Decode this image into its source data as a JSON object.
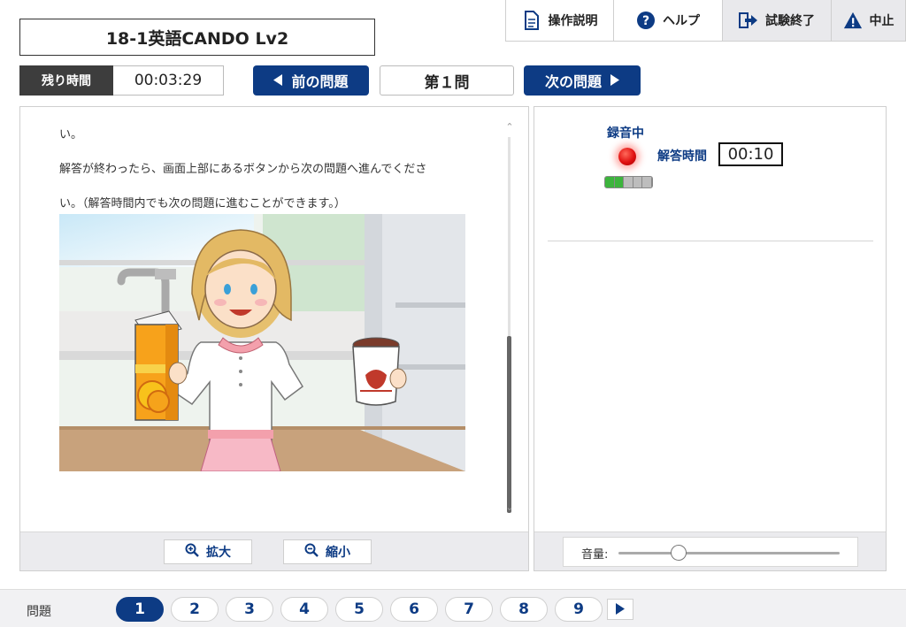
{
  "header": {
    "title": "18-1英語CANDO Lv2",
    "toolbar": {
      "manual": {
        "label": "操作説明",
        "icon": "document-icon"
      },
      "help": {
        "label": "ヘルプ",
        "icon": "question-icon"
      },
      "finish": {
        "label": "試験終了",
        "icon": "exit-icon"
      },
      "abort": {
        "label": "中止",
        "icon": "warning-icon"
      }
    }
  },
  "timer": {
    "label": "残り時間",
    "value": "00:03:29"
  },
  "navigation": {
    "prev_label": "前の問題",
    "current_label": "第１問",
    "next_label": "次の問題"
  },
  "content": {
    "paragraphs": [
      "い。",
      "解答が終わったら、画面上部にあるボタンから次の問題へ進んでくださ",
      "い。（解答時間内でも次の問題に進むことができます。）"
    ],
    "illustration": "woman-holding-juice-and-jar"
  },
  "left_footer": {
    "zoom_in_label": "拡大",
    "zoom_out_label": "縮小"
  },
  "recording": {
    "status_label": "録音中",
    "answer_time_label": "解答時間",
    "answer_time_value": "00:10",
    "level_fraction": 0.4
  },
  "volume": {
    "label": "音量:",
    "level_fraction": 0.27
  },
  "question_bar": {
    "label": "問題",
    "numbers": [
      "1",
      "2",
      "3",
      "4",
      "5",
      "6",
      "7",
      "8",
      "9"
    ],
    "active": "1"
  },
  "colors": {
    "accent": "#0d3b84",
    "timer_dark": "#3d3d3d",
    "recording_red": "#e01010",
    "level_green": "#3cb43c"
  }
}
